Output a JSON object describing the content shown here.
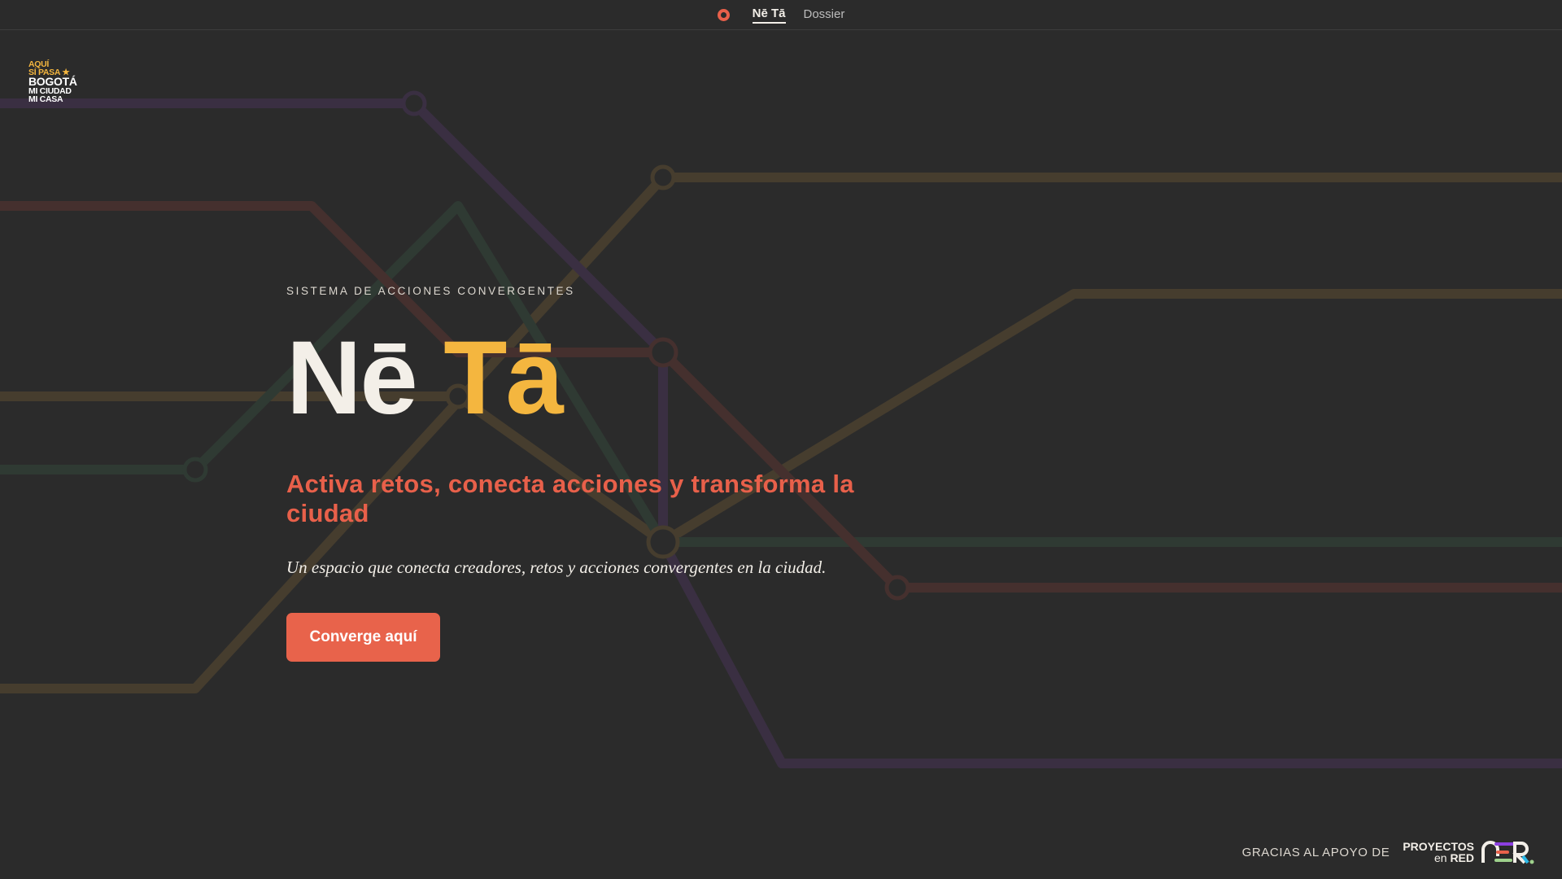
{
  "nav": {
    "items": [
      {
        "label": "Nē Tā",
        "active": true
      },
      {
        "label": "Dossier",
        "active": false
      }
    ]
  },
  "logo": {
    "lines": [
      "AQUÍ",
      "SÍ PASA",
      "BOGOTÁ",
      "MI CIUDAD",
      "MI CASA"
    ]
  },
  "hero": {
    "eyebrow": "SISTEMA DE ACCIONES CONVERGENTES",
    "title_part1": "Nē",
    "title_part2": "Tā",
    "subtitle": "Activa retos, conecta acciones y transforma la ciudad",
    "description": "Un espacio que conecta creadores, retos y acciones convergentes en la ciudad.",
    "cta": "Converge aquí"
  },
  "footer": {
    "thanks": "GRACIAS AL APOYO DE",
    "partner_line1": "PROYECTOS",
    "partner_line2_a": "en",
    "partner_line2_b": "RED"
  },
  "colors": {
    "background": "#2b2b2b",
    "accent": "#e8604a",
    "yellow": "#f4b63f",
    "line_purple": "#3a2f42",
    "line_red": "#45302e",
    "line_green": "#2f3a33",
    "line_olive": "#463d2e"
  }
}
